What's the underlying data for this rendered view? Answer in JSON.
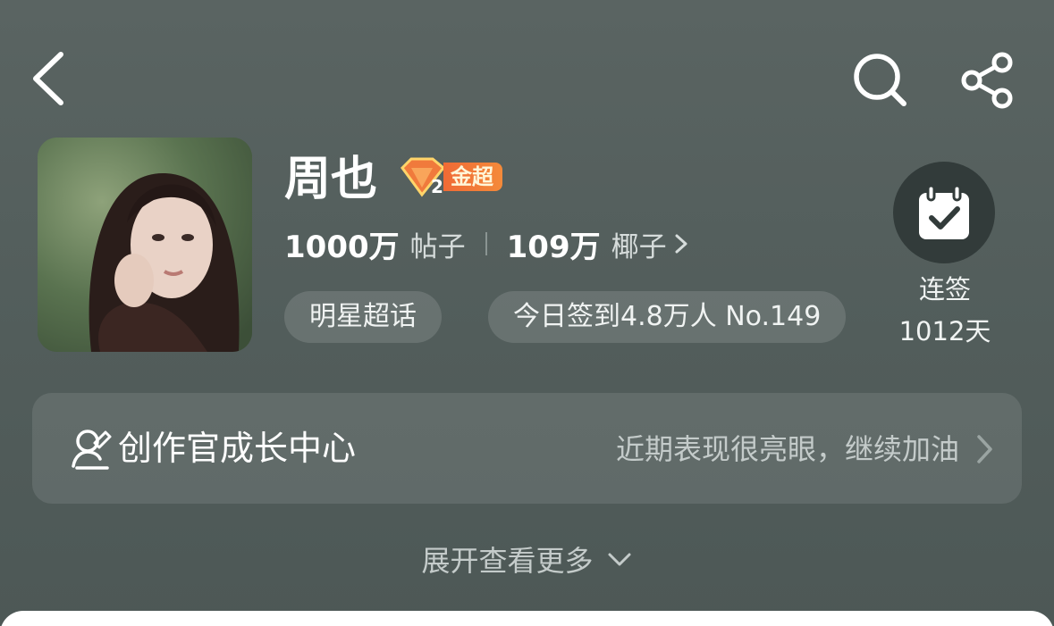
{
  "header": {
    "back_icon": "chevron-left-icon",
    "search_icon": "search-icon",
    "share_icon": "share-icon"
  },
  "profile": {
    "avatar": "avatar-photo",
    "name": "周也",
    "badge": {
      "icon": "diamond-level-icon",
      "label": "金超",
      "color": "#f06a35"
    },
    "posts_count": "1000万",
    "posts_label": "帖子",
    "coconuts_count": "109万",
    "coconuts_label": "椰子",
    "category_chip": "明星超话",
    "checkin_chip": "今日签到4.8万人 No.149"
  },
  "signin": {
    "icon": "calendar-check-icon",
    "label": "连签",
    "days": "1012天"
  },
  "growth_center": {
    "icon": "pen-person-icon",
    "title": "创作官成长中心",
    "subtitle": "近期表现很亮眼，继续加油",
    "arrow_icon": "chevron-right-icon"
  },
  "expand": {
    "label": "展开查看更多",
    "icon": "chevron-down-icon"
  }
}
